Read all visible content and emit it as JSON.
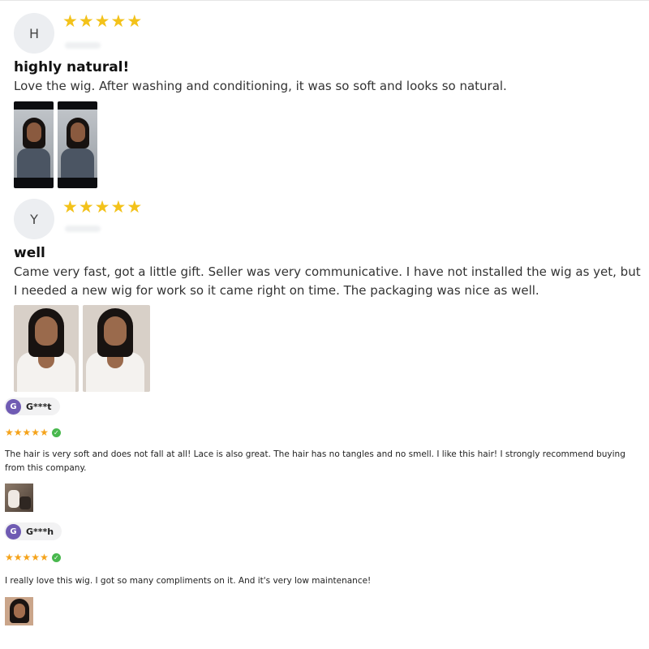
{
  "reviews_big": [
    {
      "avatar_letter": "H",
      "stars": [
        "★",
        "★",
        "★",
        "★",
        "★"
      ],
      "title": "highly natural!",
      "text": "Love the wig. After washing and conditioning, it was so soft and looks so natural."
    },
    {
      "avatar_letter": "Y",
      "stars": [
        "★",
        "★",
        "★",
        "★",
        "★"
      ],
      "title": "well",
      "text": "Came very fast, got a little gift. Seller was very communicative. I have not installed the wig as yet, but I needed a new wig for work so it came right on time. The packaging was nice as well."
    }
  ],
  "reviews_small": [
    {
      "avatar_letter": "G",
      "reviewer": "G***t",
      "stars": [
        "★",
        "★",
        "★",
        "★",
        "★"
      ],
      "verified_icon": "check-icon",
      "text": "The hair is very soft and does not fall at all! Lace is also great. The hair has no tangles and no smell. I like this hair! I strongly recommend buying from this company."
    },
    {
      "avatar_letter": "G",
      "reviewer": "G***h",
      "stars": [
        "★",
        "★",
        "★",
        "★",
        "★"
      ],
      "verified_icon": "check-icon",
      "text": "I really love this wig. I got so many compliments on it. And it's very low maintenance!"
    }
  ],
  "colors": {
    "star_big": "#f3c21a",
    "star_small": "#f5a31a",
    "avatar_purple": "#6f5bb3",
    "verified_green": "#49b84e"
  }
}
